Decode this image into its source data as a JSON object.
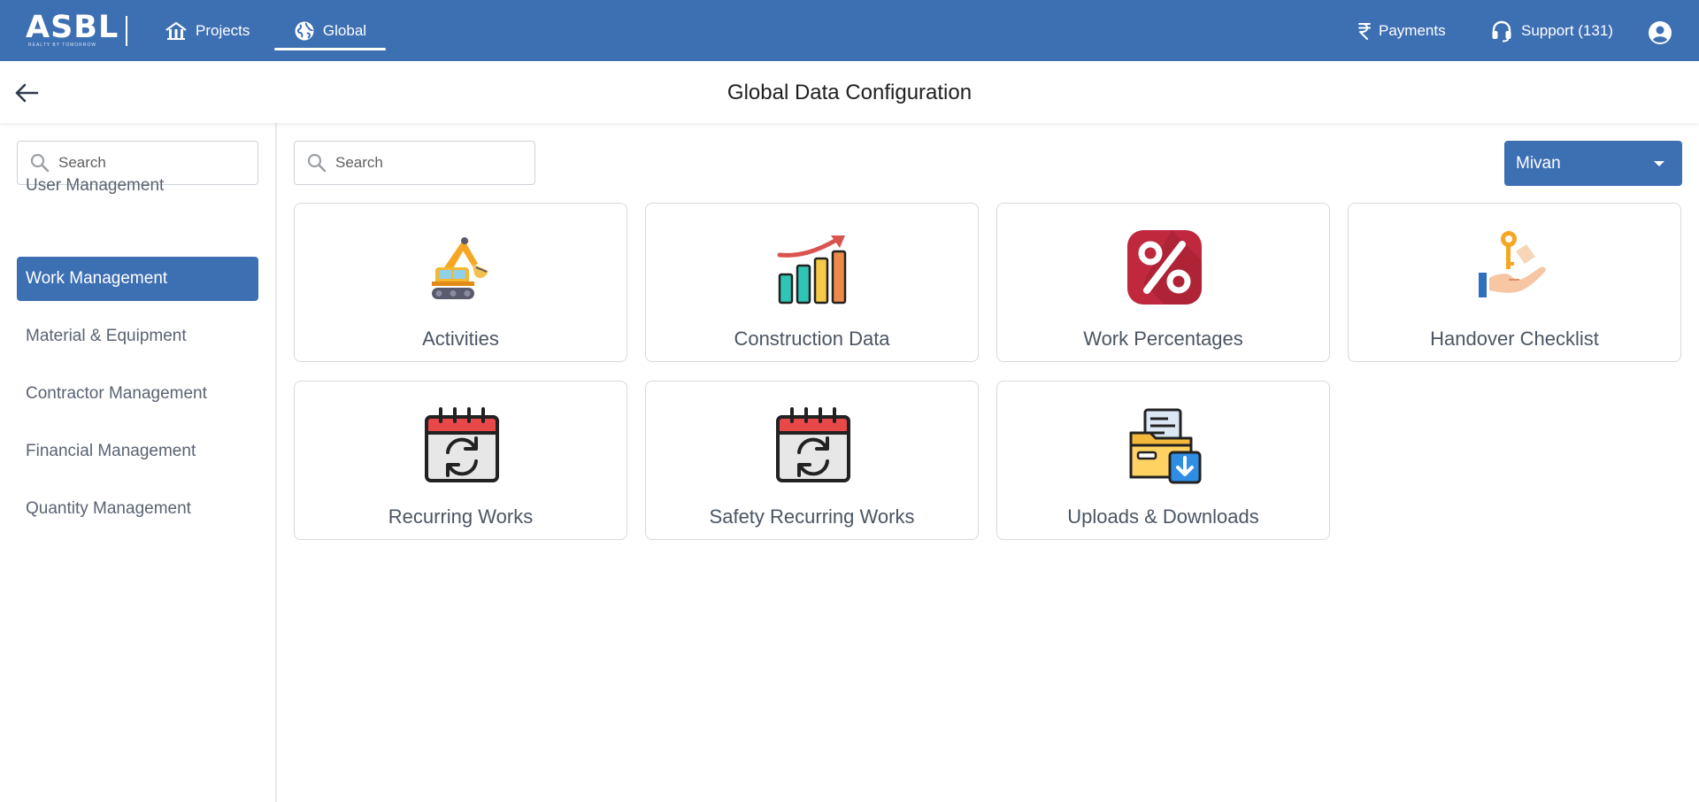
{
  "app": {
    "logo": "ASBL",
    "logo_sub": "REALTY BY TOMORROW"
  },
  "topnav": {
    "projects_label": "Projects",
    "global_label": "Global",
    "payments_label": "Payments",
    "support_label": "Support (131)"
  },
  "header": {
    "title": "Global Data Configuration"
  },
  "sidebar": {
    "search_placeholder": "Search",
    "items": [
      {
        "label": "User Management"
      },
      {
        "label": "Work Management"
      },
      {
        "label": "Material & Equipment"
      },
      {
        "label": "Contractor Management"
      },
      {
        "label": "Financial Management"
      },
      {
        "label": "Quantity Management"
      }
    ],
    "active_index": 1
  },
  "main": {
    "search_placeholder": "Search",
    "dropdown_selected": "Mivan",
    "cards": [
      {
        "label": "Activities",
        "icon": "excavator-icon"
      },
      {
        "label": "Construction Data",
        "icon": "growth-chart-icon"
      },
      {
        "label": "Work Percentages",
        "icon": "percent-icon"
      },
      {
        "label": "Handover Checklist",
        "icon": "key-handover-icon"
      },
      {
        "label": "Recurring Works",
        "icon": "recurring-calendar-icon"
      },
      {
        "label": "Safety Recurring Works",
        "icon": "recurring-calendar-icon"
      },
      {
        "label": "Uploads & Downloads",
        "icon": "folder-download-icon"
      }
    ]
  },
  "colors": {
    "brand": "#3d6fb3",
    "text": "#4b5563"
  }
}
